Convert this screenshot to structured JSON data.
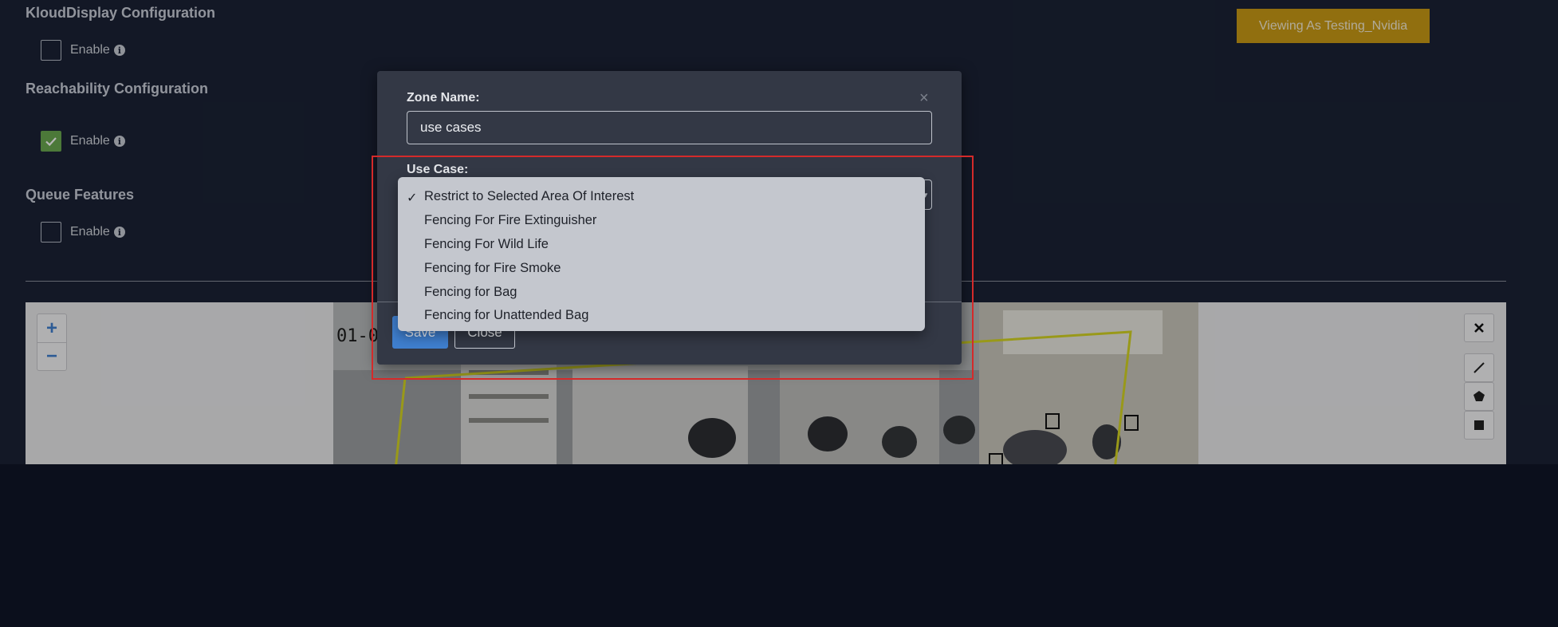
{
  "settings": {
    "kloud_display": {
      "title": "KloudDisplay Configuration",
      "enable_label": "Enable",
      "checked": false
    },
    "reachability": {
      "title": "Reachability Configuration",
      "enable_label": "Enable",
      "checked": true
    },
    "queue": {
      "title": "Queue Features",
      "enable_label": "Enable",
      "checked": false
    }
  },
  "header": {
    "viewing_as": "Viewing As Testing_Nvidia"
  },
  "map": {
    "zoom_in": "+",
    "zoom_out": "−",
    "camera_timestamp": "01-0",
    "icons": [
      "close-icon",
      "line-draw-icon",
      "polygon-draw-icon",
      "square-draw-icon"
    ]
  },
  "modal": {
    "zone_name_label": "Zone Name:",
    "zone_name_value": "use cases",
    "use_case_label": "Use Case:",
    "save_label": "Save",
    "close_label": "Close",
    "close_icon": "×"
  },
  "dropdown": {
    "selected_mark": "✓",
    "options": [
      {
        "label": "Restrict to Selected Area Of Interest",
        "selected": true
      },
      {
        "label": "Fencing For Fire Extinguisher",
        "selected": false
      },
      {
        "label": "Fencing For Wild Life",
        "selected": false
      },
      {
        "label": "Fencing for Fire Smoke",
        "selected": false
      },
      {
        "label": "Fencing for Bag",
        "selected": false
      },
      {
        "label": "Fencing for Unattended Bag",
        "selected": false
      }
    ]
  },
  "colors": {
    "page_bg": "#1b2235",
    "accent_button": "#c99a16",
    "primary_button": "#3f7fcf",
    "checkbox_checked": "#6aa84f",
    "highlight_border": "#d42a2a"
  }
}
